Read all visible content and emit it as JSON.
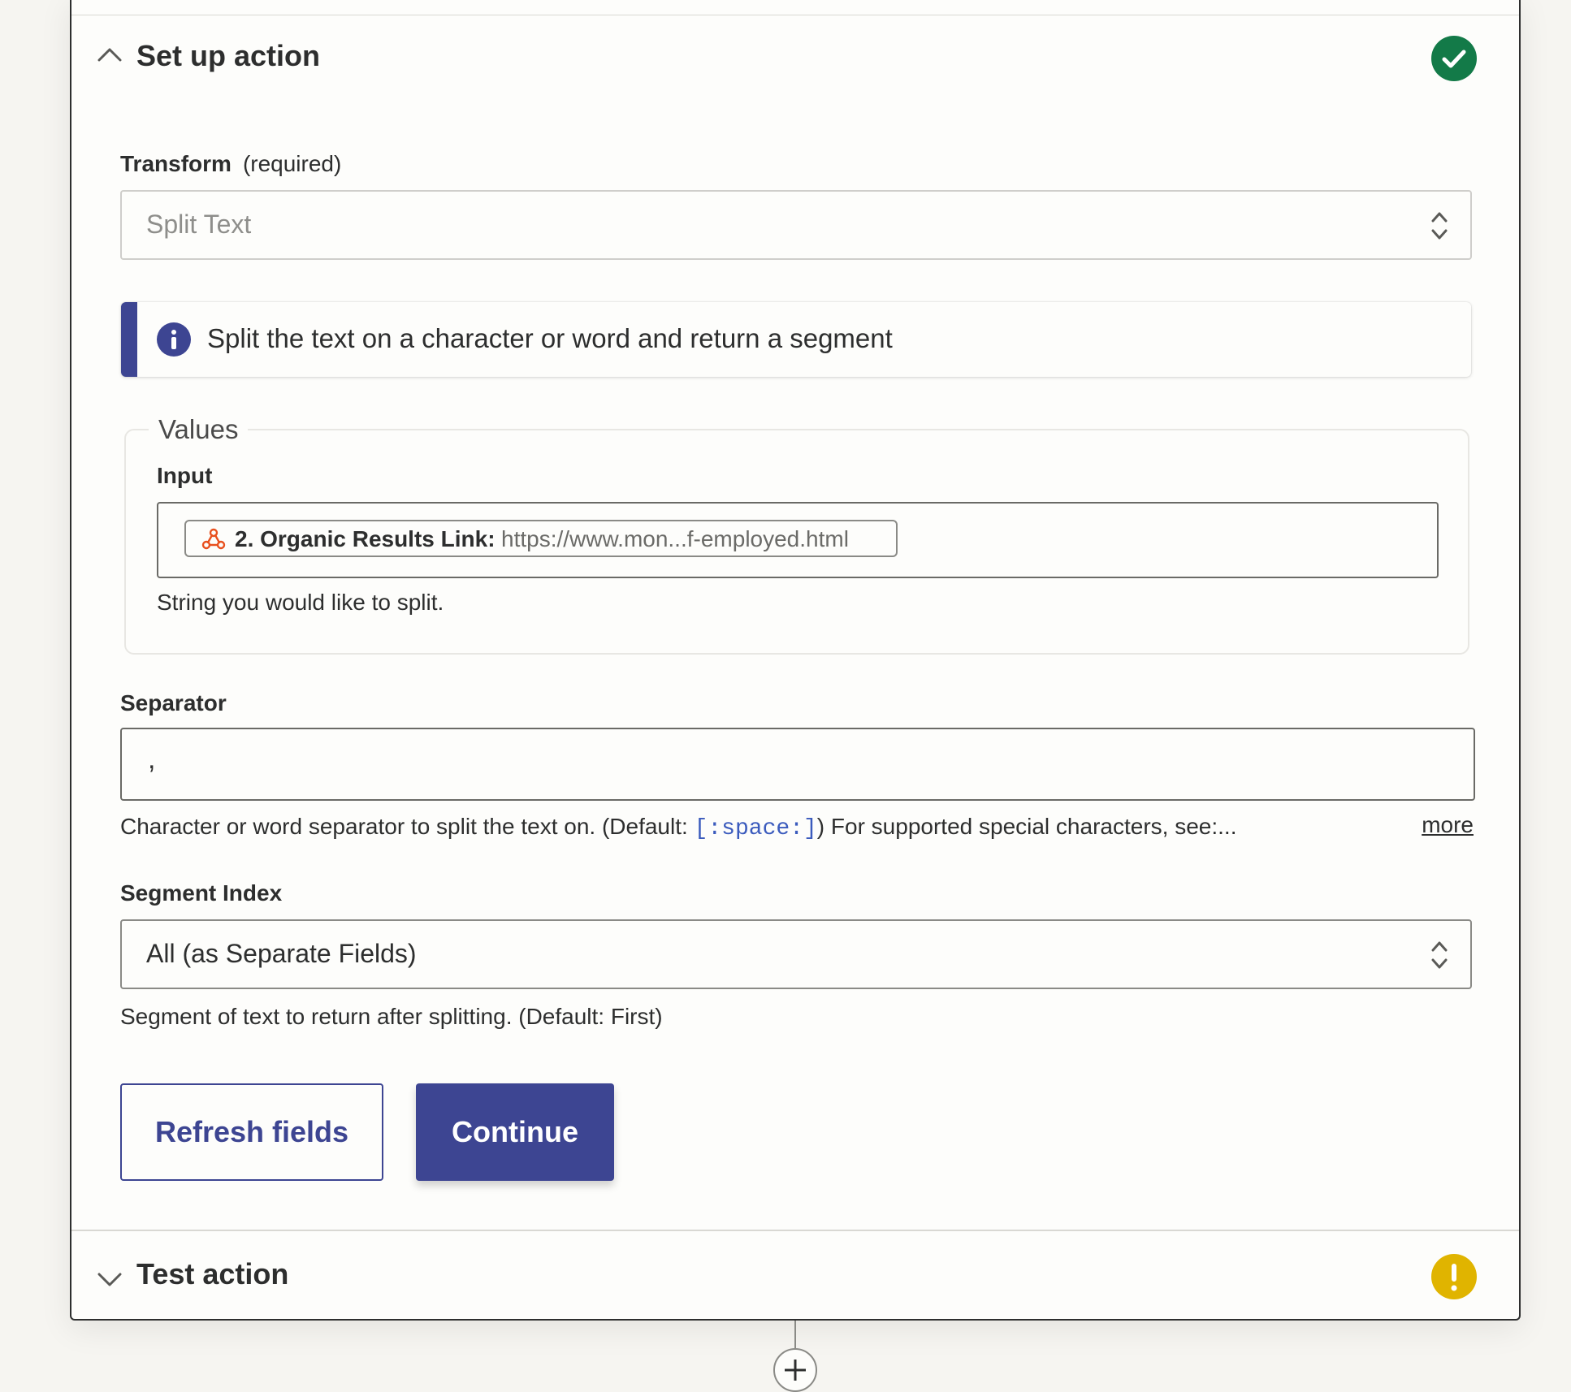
{
  "setup_section": {
    "title": "Set up action",
    "status": "complete",
    "status_color": "#137a48"
  },
  "transform": {
    "label": "Transform",
    "required": "(required)",
    "value": "Split Text"
  },
  "info": {
    "text": "Split the text on a character or word and return a segment",
    "accent_color": "#3d4592"
  },
  "values": {
    "legend": "Values",
    "input_label": "Input",
    "pill_name": "2. Organic Results Link:",
    "pill_value": "https://www.mon...f-employed.html",
    "pill_icon": "webhook-icon",
    "help": "String you would like to split."
  },
  "separator": {
    "label": "Separator",
    "value": ",",
    "help_prefix": "Character or word separator to split the text on. (Default: ",
    "help_code": "[:space:]",
    "help_suffix": ") For supported special characters, see:...",
    "more": "more"
  },
  "segment_index": {
    "label": "Segment Index",
    "value": "All (as Separate Fields)",
    "help": "Segment of text to return after splitting. (Default: First)"
  },
  "buttons": {
    "refresh": "Refresh fields",
    "continue": "Continue"
  },
  "test_section": {
    "title": "Test action",
    "status": "warning",
    "status_color": "#e0b400"
  }
}
